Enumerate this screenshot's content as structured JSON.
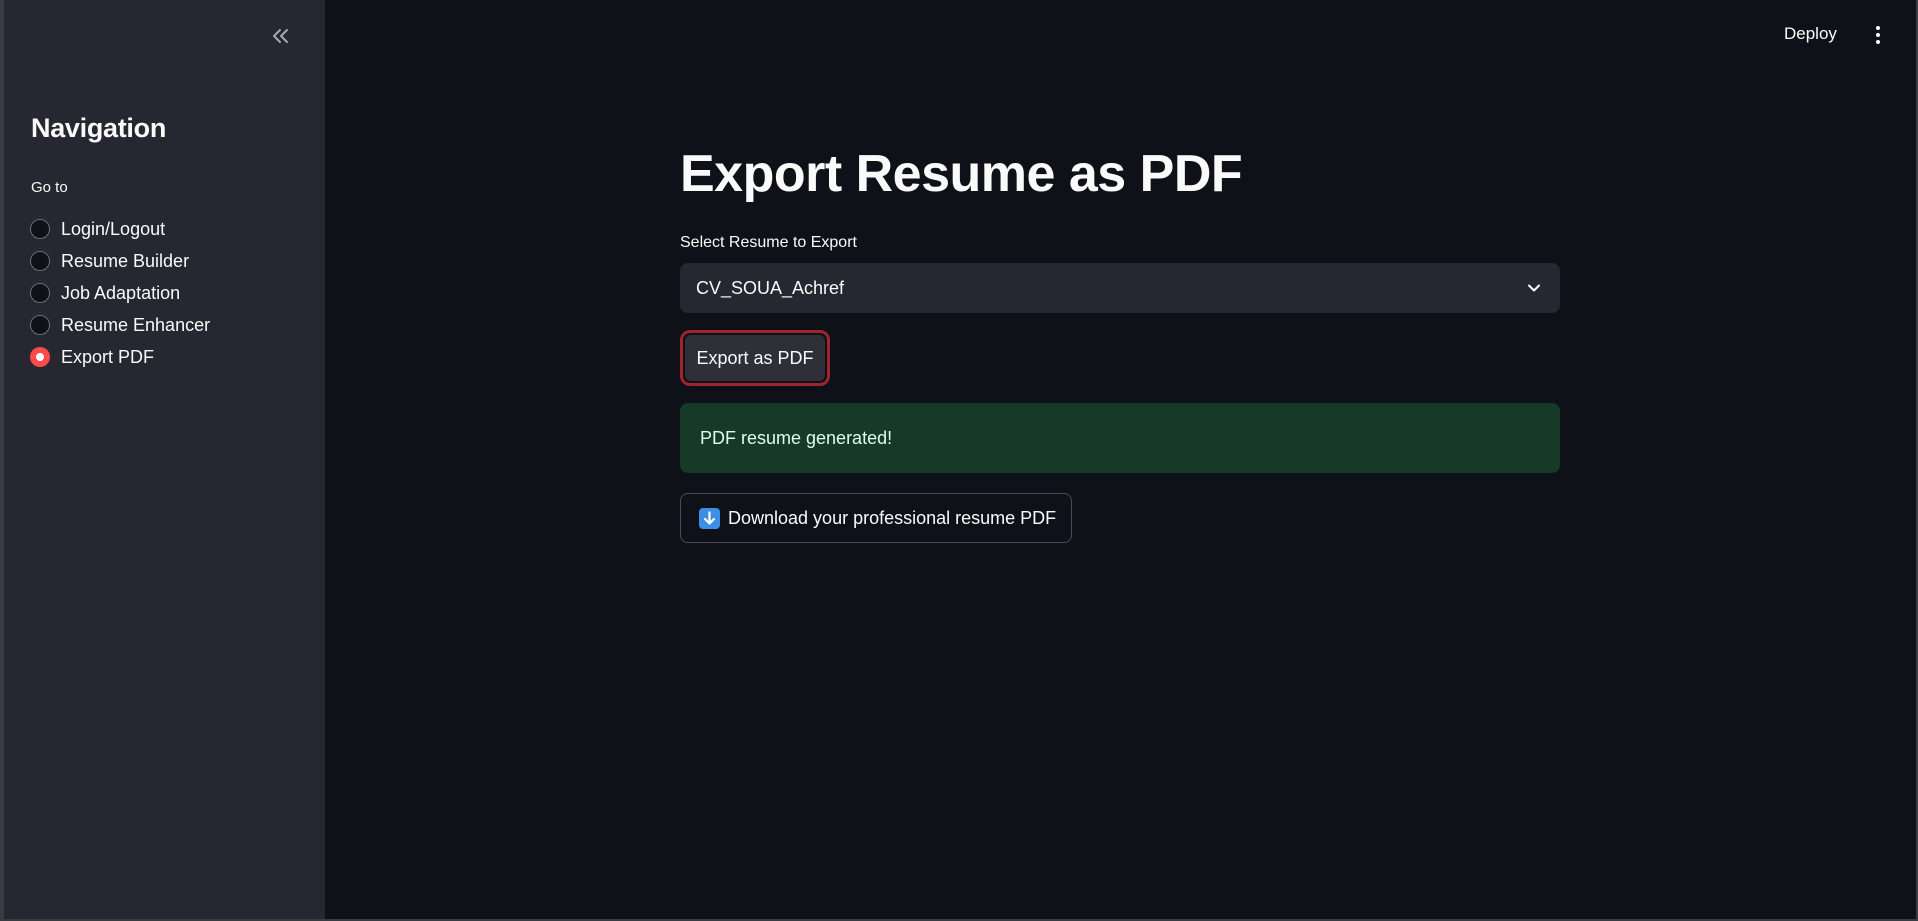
{
  "sidebar": {
    "collapse_icon": "double-chevron-left-icon",
    "title": "Navigation",
    "radio_label": "Go to",
    "items": [
      {
        "label": "Login/Logout",
        "selected": false
      },
      {
        "label": "Resume Builder",
        "selected": false
      },
      {
        "label": "Job Adaptation",
        "selected": false
      },
      {
        "label": "Resume Enhancer",
        "selected": false
      },
      {
        "label": "Export PDF",
        "selected": true
      }
    ]
  },
  "header": {
    "deploy_label": "Deploy",
    "menu_icon": "kebab-menu-icon"
  },
  "main": {
    "title": "Export Resume as PDF",
    "select_label": "Select Resume to Export",
    "select_value": "CV_SOUA_Achref",
    "export_button_label": "Export as PDF",
    "success_message": "PDF resume generated!",
    "download_button_label": "Download your professional resume PDF",
    "download_icon": "down-arrow-icon"
  },
  "colors": {
    "background": "#0e1117",
    "sidebar": "#262730",
    "accent": "#ff4b4b",
    "success_bg": "#173928",
    "success_text": "#dffde9",
    "focus_border": "#a1232e"
  }
}
